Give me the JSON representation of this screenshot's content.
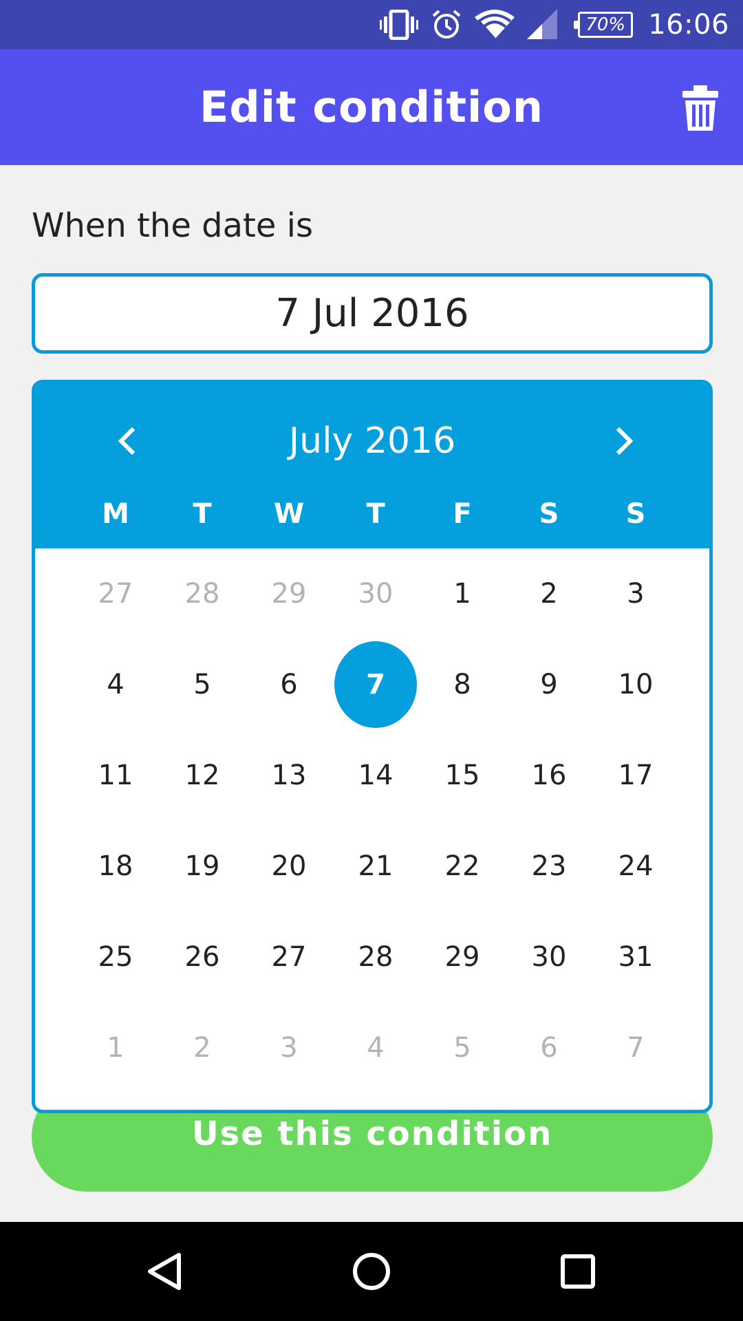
{
  "status_bar": {
    "battery_percent": "70%",
    "time": "16:06",
    "icons": [
      "vibrate-icon",
      "alarm-icon",
      "wifi-icon",
      "signal-icon",
      "battery-icon"
    ]
  },
  "app_bar": {
    "title": "Edit condition",
    "delete_icon": "trash-icon"
  },
  "form": {
    "label": "When the date is",
    "date_value": "7 Jul 2016"
  },
  "calendar": {
    "month_label": "July 2016",
    "weekdays": [
      "M",
      "T",
      "W",
      "T",
      "F",
      "S",
      "S"
    ],
    "weeks": [
      [
        "27",
        "28",
        "29",
        "30",
        "1",
        "2",
        "3"
      ],
      [
        "4",
        "5",
        "6",
        "7",
        "8",
        "9",
        "10"
      ],
      [
        "11",
        "12",
        "13",
        "14",
        "15",
        "16",
        "17"
      ],
      [
        "18",
        "19",
        "20",
        "21",
        "22",
        "23",
        "24"
      ],
      [
        "25",
        "26",
        "27",
        "28",
        "29",
        "30",
        "31"
      ],
      [
        "1",
        "2",
        "3",
        "4",
        "5",
        "6",
        "7"
      ]
    ],
    "selected_day": "7",
    "accent_color": "#069fdd"
  },
  "action": {
    "button_label": "Use this condition",
    "color": "#68d95c"
  },
  "nav_bar": {
    "icons": [
      "back-icon",
      "home-icon",
      "recents-icon"
    ]
  }
}
